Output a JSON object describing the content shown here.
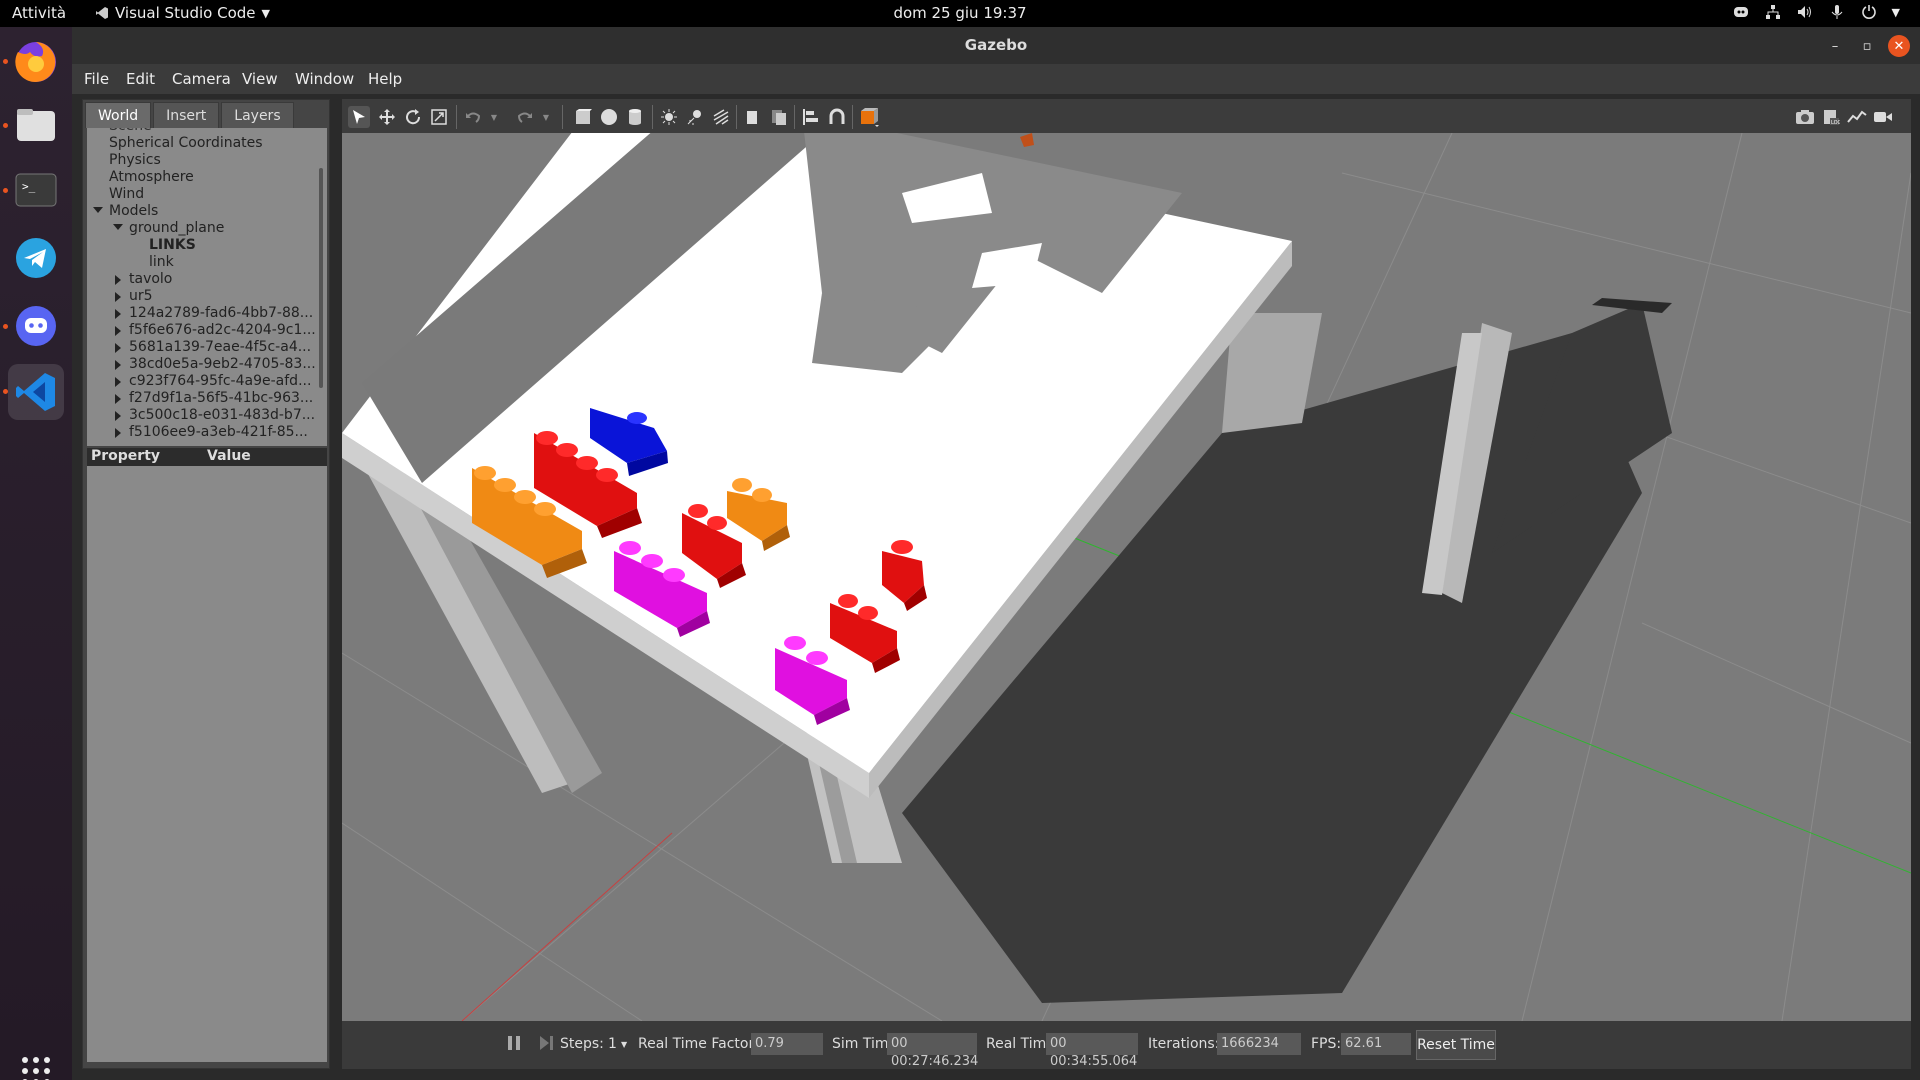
{
  "topbar": {
    "activities": "Attività",
    "app_name": "Visual Studio Code",
    "clock": "dom 25 giu  19:37"
  },
  "window": {
    "title": "Gazebo"
  },
  "menubar": {
    "items": [
      "File",
      "Edit",
      "Camera",
      "View",
      "Window",
      "Help"
    ]
  },
  "left_panel": {
    "tabs": [
      "World",
      "Insert",
      "Layers"
    ],
    "active_tab": "World",
    "tree": [
      {
        "label": "Spherical Coordinates"
      },
      {
        "label": "Physics"
      },
      {
        "label": "Atmosphere"
      },
      {
        "label": "Wind"
      },
      {
        "label": "Models"
      },
      {
        "label": "ground_plane"
      },
      {
        "label": "LINKS"
      },
      {
        "label": "link"
      },
      {
        "label": "tavolo"
      },
      {
        "label": "ur5"
      },
      {
        "label": "124a2789-fad6-4bb7-88..."
      },
      {
        "label": "f5f6e676-ad2c-4204-9c1..."
      },
      {
        "label": "5681a139-7eae-4f5c-a4..."
      },
      {
        "label": "38cd0e5a-9eb2-4705-83..."
      },
      {
        "label": "c923f764-95fc-4a9e-afd..."
      },
      {
        "label": "f27d9f1a-56f5-41bc-963..."
      },
      {
        "label": "3c500c18-e031-483d-b7..."
      },
      {
        "label": "f5106ee9-a3eb-421f-85..."
      }
    ],
    "property_header": "Property",
    "value_header": "Value"
  },
  "bottom_bar": {
    "steps_label": "Steps:",
    "steps_value": "1",
    "rtf_label": "Real Time Factor:",
    "rtf_value": "0.79",
    "sim_time_label": "Sim Time:",
    "sim_time_value": "00 00:27:46.234",
    "real_time_label": "Real Time:",
    "real_time_value": "00 00:34:55.064",
    "iterations_label": "Iterations:",
    "iterations_value": "1666234",
    "fps_label": "FPS:",
    "fps_value": "62.61",
    "reset_label": "Reset Time"
  },
  "colors": {
    "orange": "#f08a14",
    "red": "#e01010",
    "blue": "#0a14d8",
    "magenta": "#e010e0",
    "accent": "#e95420"
  }
}
